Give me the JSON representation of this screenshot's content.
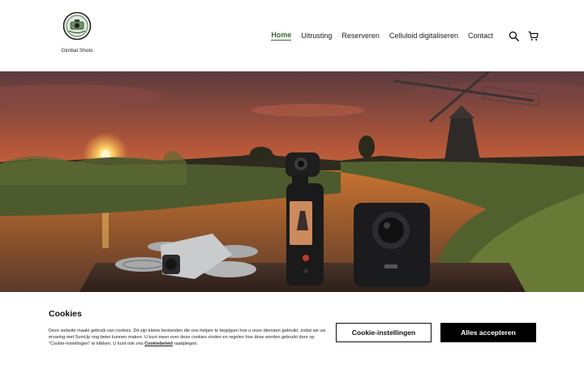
{
  "brand": {
    "name": "Gimbal Shots"
  },
  "nav": {
    "items": [
      {
        "label": "Home",
        "active": true
      },
      {
        "label": "Uitrusting",
        "active": false
      },
      {
        "label": "Reserveren",
        "active": false
      },
      {
        "label": "Celluloid digitaliseren",
        "active": false
      },
      {
        "label": "Contact",
        "active": false
      }
    ],
    "icons": [
      "search-icon",
      "cart-icon"
    ]
  },
  "cookies": {
    "title": "Cookies",
    "text_before_link": "Deze website maakt gebruik van cookies. Dit zijn kleine bestanden die ons helpen te begrijpen hoe u onze diensten gebruikt, zodat we uw ervaring met SumUp nog beter kunnen maken. U kunt meer over deze cookies vinden en regelen hoe deze worden gebruikt door op \"Cookie-instellingen\" te klikken. U kunt ook ons ",
    "link_label": "Cookiebeleid",
    "text_after_link": " raadplegen.",
    "settings_button": "Cookie-instellingen",
    "accept_button": "Alles accepteren"
  },
  "colors": {
    "accent": "#3d6b3a",
    "accept_bg": "#000000"
  }
}
